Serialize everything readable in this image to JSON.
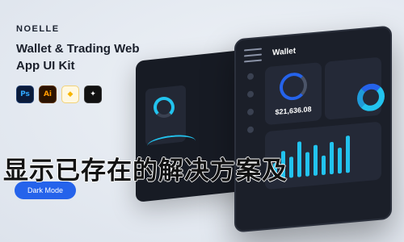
{
  "brand": "NOELLE",
  "headline": "Wallet & Trading Web App UI Kit",
  "tools": [
    {
      "icon": "photoshop-icon",
      "label": "Ps"
    },
    {
      "icon": "illustrator-icon",
      "label": "Ai"
    },
    {
      "icon": "sketch-icon",
      "label": "◆"
    },
    {
      "icon": "figma-icon",
      "label": "✦"
    }
  ],
  "mode_button": "Dark Mode",
  "screen": {
    "title": "Wallet",
    "balance": "$21,636.08"
  },
  "overlay_text": "显示已存在的解决方案及",
  "colors": {
    "accent": "#2563eb",
    "cyan": "#22c3ee",
    "panel": "#1b1f29"
  }
}
